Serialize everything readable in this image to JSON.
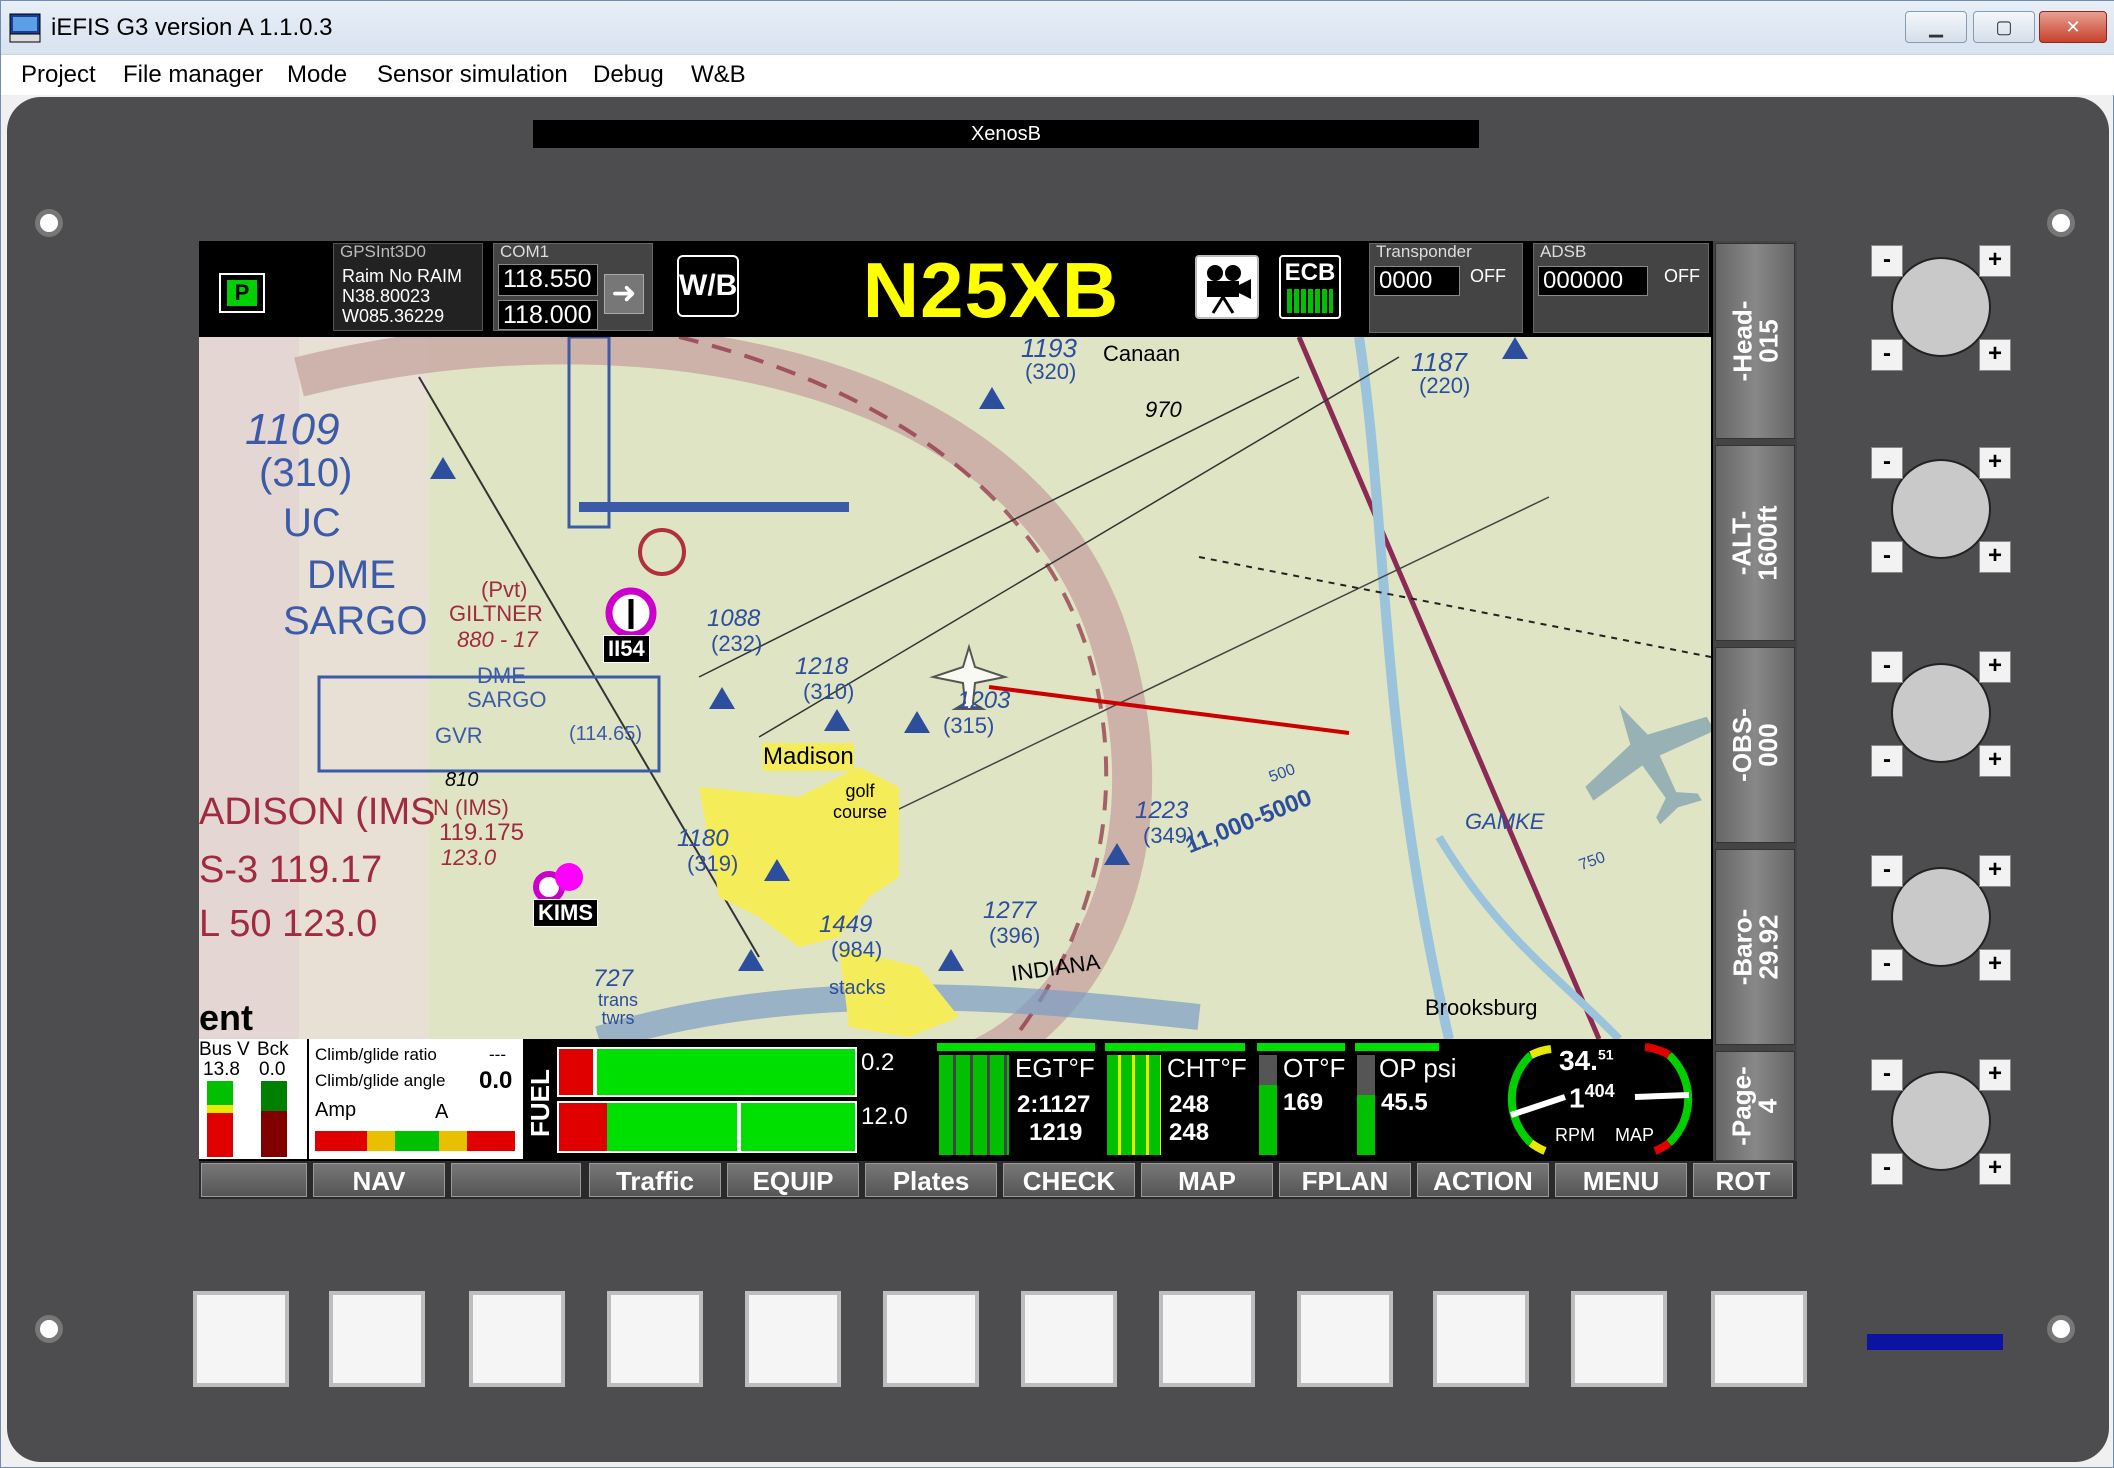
{
  "window": {
    "title": "iEFIS G3 version A 1.1.0.3",
    "icon_label": "iEFIS"
  },
  "menubar": [
    "Project",
    "File manager",
    "Mode",
    "Sensor simulation",
    "Debug",
    "W&B"
  ],
  "panel": {
    "title": "XenosB"
  },
  "topbar": {
    "status_badge": "P",
    "gps": {
      "label": "GPSInt3D0",
      "raim": "Raim   No RAIM",
      "lat": "N38.80023",
      "lon": "W085.36229"
    },
    "com": {
      "label": "COM1",
      "active": "118.550",
      "standby": "118.000"
    },
    "wb_label": "W/B",
    "callsign": "N25XB",
    "ecb_label": "ECB",
    "transponder": {
      "label": "Transponder",
      "code": "0000",
      "mode": "OFF"
    },
    "adsb": {
      "label": "ADSB",
      "code": "000000",
      "mode": "OFF"
    }
  },
  "map": {
    "labels": [
      {
        "text": "1193",
        "sub": "(320)"
      },
      {
        "text": "Canaan"
      },
      {
        "text": "970"
      },
      {
        "text": "1187",
        "sub": "(220)"
      },
      {
        "text": "1109",
        "sub": "(310)"
      },
      {
        "text": "UC"
      },
      {
        "text": "DME"
      },
      {
        "text": "SARGO"
      },
      {
        "text": "(Pvt)"
      },
      {
        "text": "GILTNER"
      },
      {
        "text": "880 - 17"
      },
      {
        "text": "1088",
        "sub": "(232)"
      },
      {
        "text": "1218",
        "sub": "(310)"
      },
      {
        "text": "1203",
        "sub": "(315)"
      },
      {
        "text": "DME"
      },
      {
        "text": "SARGO"
      },
      {
        "text": "GVR"
      },
      {
        "text": "(114.65)"
      },
      {
        "text": "Madison"
      },
      {
        "text": "golf course"
      },
      {
        "text": "1223",
        "sub": "(349)"
      },
      {
        "text": "GAMKE"
      },
      {
        "text": "11,000-5000"
      },
      {
        "text": "810"
      },
      {
        "text": "ADISON (IMS"
      },
      {
        "text": "N (IMS)"
      },
      {
        "text": "119.175"
      },
      {
        "text": "123.0"
      },
      {
        "text": "S-3 119.17"
      },
      {
        "text": "L 50 123.0"
      },
      {
        "text": "1180",
        "sub": "(319)"
      },
      {
        "text": "1277",
        "sub": "(396)"
      },
      {
        "text": "1449",
        "sub": "(984)"
      },
      {
        "text": "INDIANA"
      },
      {
        "text": "727"
      },
      {
        "text": "trans twrs"
      },
      {
        "text": "stacks"
      },
      {
        "text": "Brooksburg"
      },
      {
        "text": "ent"
      },
      {
        "text": "750"
      },
      {
        "text": "500"
      }
    ],
    "waypoints": [
      {
        "id": "II54"
      },
      {
        "id": "KIMS"
      }
    ]
  },
  "right_softkeys": [
    {
      "line1": "-Head-",
      "line2": "015"
    },
    {
      "line1": "-ALT-",
      "line2": "1600ft"
    },
    {
      "line1": "-OBS-",
      "line2": "000"
    },
    {
      "line1": "-Baro-",
      "line2": "29.92"
    },
    {
      "line1": "-Page-",
      "line2": "4"
    }
  ],
  "engine": {
    "bus_label": "Bus V",
    "bck_label": "Bck",
    "bus_value": "13.8",
    "bck_value": "0.0",
    "climb_ratio_label": "Climb/glide ratio",
    "climb_ratio_value": "---",
    "climb_angle_label": "Climb/glide angle",
    "climb_angle_value": "0.0",
    "amp_label": "Amp",
    "amp_unit": "A",
    "fuel_label": "FUEL",
    "fuel_top": "0.2",
    "fuel_bottom": "12.0",
    "egt_label": "EGT°F",
    "egt_line1": "2:1127",
    "egt_line2": "1219",
    "cht_label": "CHT°F",
    "cht_line1": "248",
    "cht_line2": "248",
    "ot_label": "OT°F",
    "ot_value": "169",
    "op_label": "OP psi",
    "op_value": "45.5",
    "map_value": "34.",
    "map_value_sub": "51",
    "rpm_value": "1",
    "rpm_value_sub": "404",
    "rpm_label": "RPM",
    "map_label": "MAP"
  },
  "bottom_softkeys": [
    "",
    "NAV",
    "",
    "Traffic",
    "EQUIP",
    "Plates",
    "CHECK",
    "MAP",
    "FPLAN",
    "ACTION",
    "MENU",
    "ROT"
  ],
  "knob_plus": "+",
  "knob_minus": "-",
  "colors": {
    "callsign": "#ffff00",
    "bezel": "#4d4d4f",
    "route_line": "#cc0000",
    "bar_green": "#00e000",
    "bar_red": "#e00000"
  }
}
